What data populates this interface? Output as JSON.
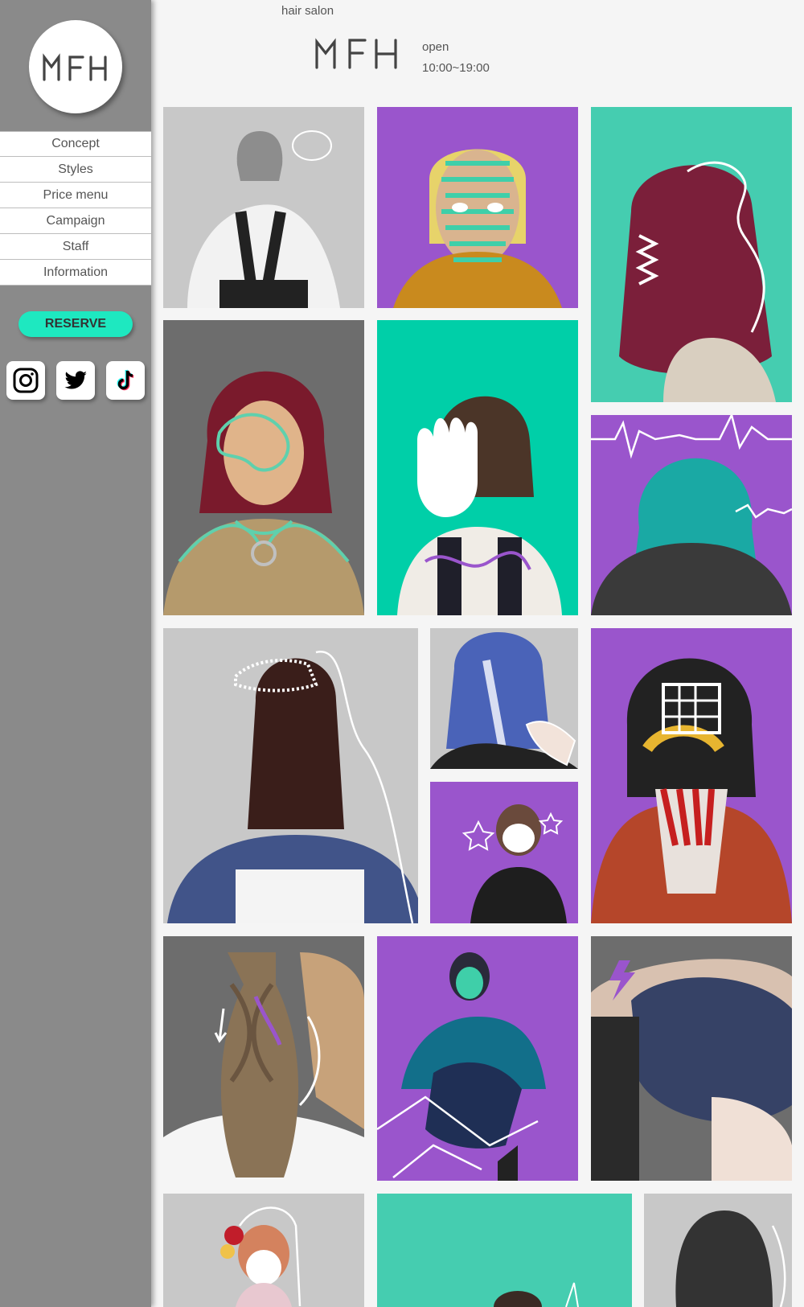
{
  "sidebar": {
    "logo_text": "MFH",
    "menu": [
      {
        "label": "Concept"
      },
      {
        "label": "Styles"
      },
      {
        "label": "Price menu"
      },
      {
        "label": "Campaign"
      },
      {
        "label": "Staff"
      },
      {
        "label": "Information"
      }
    ],
    "reserve_label": "RESERVE",
    "social": [
      {
        "icon": "instagram-icon"
      },
      {
        "icon": "twitter-icon"
      },
      {
        "icon": "tiktok-icon"
      }
    ]
  },
  "header": {
    "tagline": "hair salon",
    "brand": "MFH",
    "open_label": "open",
    "hours": "10:00~19:00"
  },
  "colors": {
    "accent_teal": "#1ee8c0",
    "photo_purple": "#9a55cc",
    "photo_teal": "#00cfa8",
    "sidebar_gray": "#8a8a8a"
  }
}
